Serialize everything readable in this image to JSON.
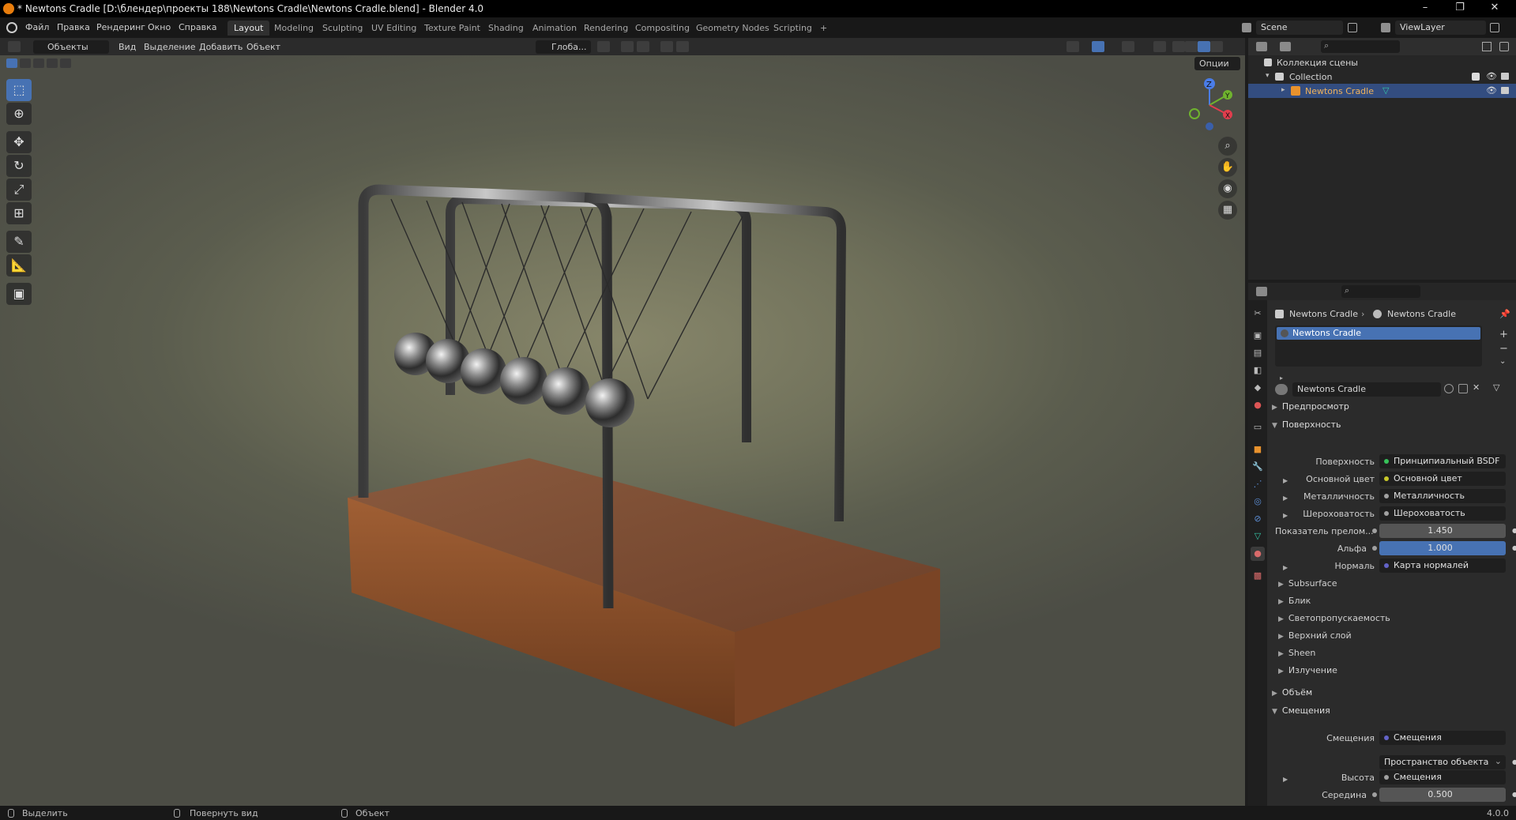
{
  "window": {
    "title": "* Newtons Cradle [D:\\блендер\\проекты 188\\Newtons Cradle\\Newtons Cradle.blend] - Blender 4.0",
    "minimize": "–",
    "maximize": "❐",
    "close": "✕"
  },
  "menu": [
    "Файл",
    "Правка",
    "Рендеринг",
    "Окно",
    "Справка"
  ],
  "workspaces": [
    "Layout",
    "Modeling",
    "Sculpting",
    "UV Editing",
    "Texture Paint",
    "Shading",
    "Animation",
    "Rendering",
    "Compositing",
    "Geometry Nodes",
    "Scripting",
    "+"
  ],
  "active_workspace": "Layout",
  "scene": {
    "name": "Scene",
    "view_layer": "ViewLayer"
  },
  "viewport_header": {
    "mode": "Объекты",
    "menus": [
      "Вид",
      "Выделение",
      "Добавить",
      "Объект"
    ],
    "transform_orientation": "Глоба...",
    "options": "Опции"
  },
  "gizmo_axes": {
    "z": "Z",
    "y": "Y",
    "x": "X"
  },
  "outliner": {
    "root": "Коллекция сцены",
    "collection": "Collection",
    "object": "Newtons Cradle"
  },
  "properties": {
    "breadcrumb_object": "Newtons Cradle",
    "breadcrumb_material": "Newtons Cradle",
    "slot": "Newtons Cradle",
    "material_name": "Newtons Cradle",
    "sections": {
      "preview": "Предпросмотр",
      "surface": "Поверхность",
      "volume": "Объём",
      "displacement": "Смещения"
    },
    "surface_label": "Поверхность",
    "surface_shader": "Принципиальный BSDF",
    "rows": [
      {
        "label": "Основной цвет",
        "value": "Основной цвет",
        "dot": "#c7c729"
      },
      {
        "label": "Металличность",
        "value": "Металличность",
        "dot": "#a1a1a1"
      },
      {
        "label": "Шероховатость",
        "value": "Шероховатость",
        "dot": "#a1a1a1"
      }
    ],
    "ior_label": "Показатель прелом...",
    "ior_value": "1.450",
    "alpha_label": "Альфа",
    "alpha_value": "1.000",
    "normal_label": "Нормаль",
    "normal_value": "Карта нормалей",
    "subsections": [
      "Subsurface",
      "Блик",
      "Светопропускаемость",
      "Верхний слой",
      "Sheen",
      "Излучение"
    ],
    "disp_label": "Смещения",
    "disp_value": "Смещения",
    "disp_space": "Пространство объекта",
    "height_label": "Высота",
    "height_value": "Смещения",
    "midlevel_label": "Середина",
    "midlevel_value": "0.500"
  },
  "status": {
    "select": "Выделить",
    "rotate": "Повернуть вид",
    "object": "Объект",
    "version": "4.0.0"
  },
  "colors": {
    "accent": "#4772b3",
    "selection": "#334d80",
    "wood": "#7a4a2e",
    "chrome": "#9a9a9a"
  }
}
